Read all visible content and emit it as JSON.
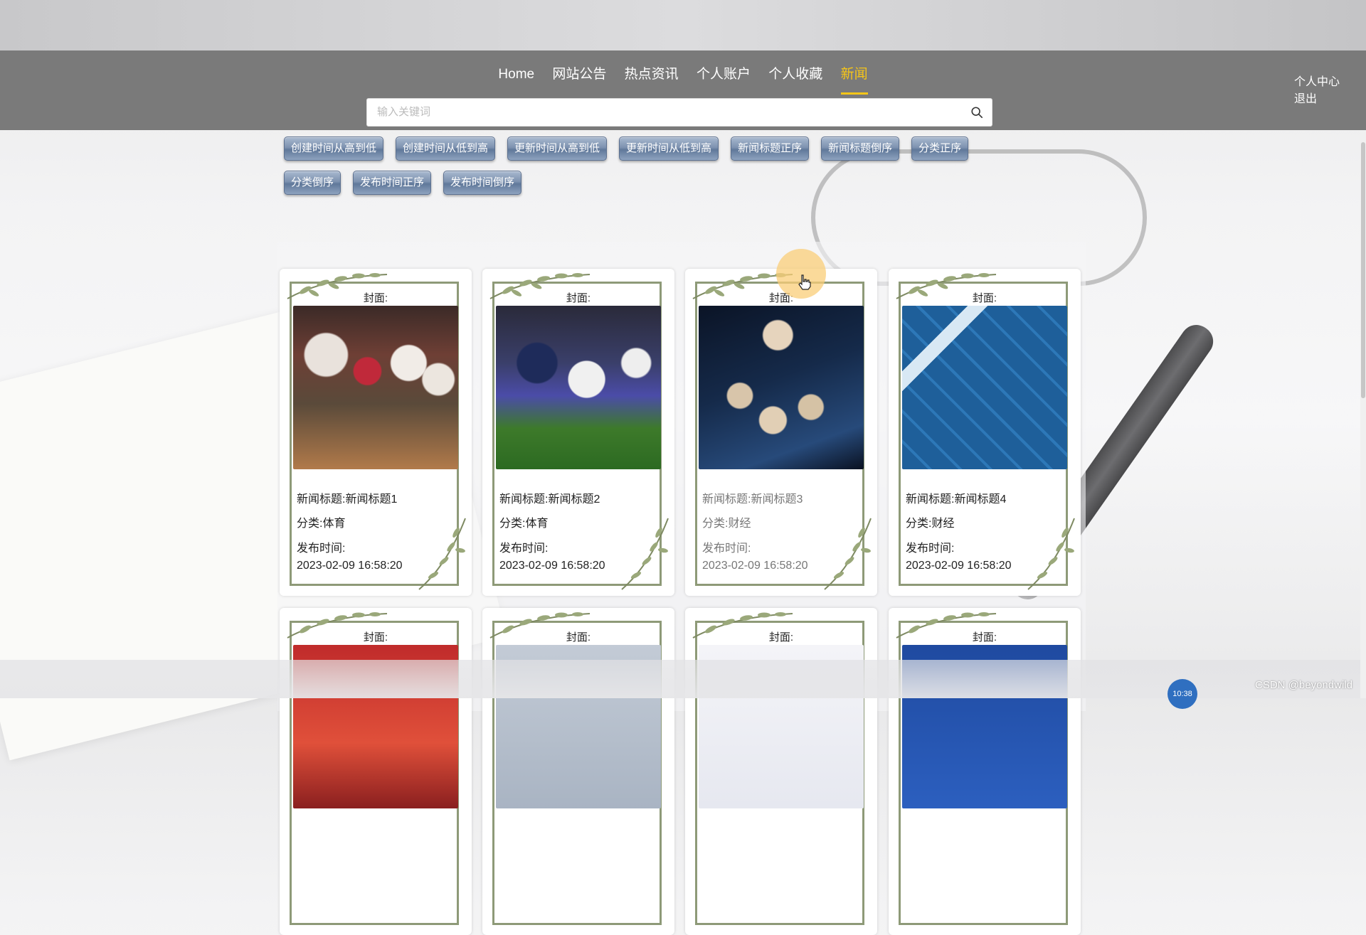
{
  "nav": {
    "items": [
      "Home",
      "网站公告",
      "热点资讯",
      "个人账户",
      "个人收藏",
      "新闻"
    ],
    "active_index": 5
  },
  "user_menu": {
    "center": "个人中心",
    "logout": "退出"
  },
  "search": {
    "placeholder": "输入关键词",
    "value": ""
  },
  "sort_buttons": [
    "创建时间从高到低",
    "创建时间从低到高",
    "更新时间从高到低",
    "更新时间从低到高",
    "新闻标题正序",
    "新闻标题倒序",
    "分类正序",
    "分类倒序",
    "发布时间正序",
    "发布时间倒序"
  ],
  "cards": [
    {
      "cover_label": "封面:",
      "title": "新闻标题:新闻标题1",
      "category": "分类:体育",
      "time_label": "发布时间:",
      "time": "2023-02-09 16:58:20"
    },
    {
      "cover_label": "封面:",
      "title": "新闻标题:新闻标题2",
      "category": "分类:体育",
      "time_label": "发布时间:",
      "time": "2023-02-09 16:58:20"
    },
    {
      "cover_label": "封面:",
      "title": "新闻标题:新闻标题3",
      "category": "分类:财经",
      "time_label": "发布时间:",
      "time": "2023-02-09 16:58:20"
    },
    {
      "cover_label": "封面:",
      "title": "新闻标题:新闻标题4",
      "category": "分类:财经",
      "time_label": "发布时间:",
      "time": "2023-02-09 16:58:20"
    }
  ],
  "cards_row2": [
    {
      "cover_label": "封面:"
    },
    {
      "cover_label": "封面:"
    },
    {
      "cover_label": "封面:"
    },
    {
      "cover_label": "封面:"
    }
  ],
  "accent_color": "#f5c518",
  "watermark": "CSDN @beyondwild",
  "clock": "10:38"
}
